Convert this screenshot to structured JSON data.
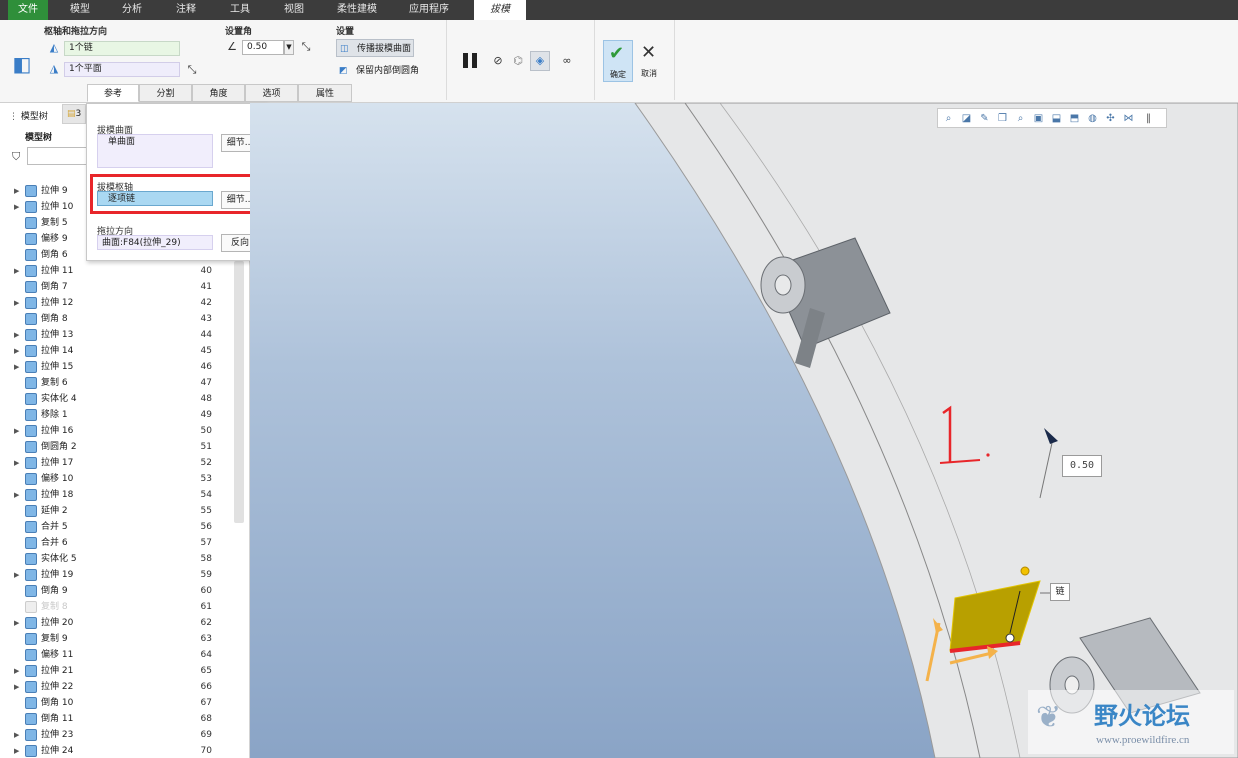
{
  "menubar": {
    "tabs": [
      {
        "label": "文件"
      },
      {
        "label": "模型"
      },
      {
        "label": "分析"
      },
      {
        "label": "注释"
      },
      {
        "label": "工具"
      },
      {
        "label": "视图"
      },
      {
        "label": "柔性建模"
      },
      {
        "label": "应用程序"
      },
      {
        "label": "拔模"
      }
    ]
  },
  "ribbon": {
    "pivot_group_title": "枢轴和拖拉方向",
    "pivot_value": "1个链",
    "pull_value": "1个平面",
    "angle_group_title": "设置角",
    "angle_value": "0.50",
    "settings_group_title": "设置",
    "propagate_label": "传播拔模曲面",
    "keep_round_label": "保留内部倒圆角",
    "ok_label": "确定",
    "cancel_label": "取消",
    "subtabs": [
      {
        "label": "参考"
      },
      {
        "label": "分割"
      },
      {
        "label": "角度"
      },
      {
        "label": "选项"
      },
      {
        "label": "属性"
      }
    ]
  },
  "leftpanel": {
    "tab_model_tree": "模型树",
    "tab_second": "3",
    "tree_header": "模型树",
    "rows": [
      {
        "label": "拉伸 9",
        "num": "",
        "arrow": true
      },
      {
        "label": "拉伸 10",
        "num": "",
        "arrow": true
      },
      {
        "label": "复制 5",
        "num": "",
        "arrow": false
      },
      {
        "label": "偏移 9",
        "num": "",
        "arrow": false
      },
      {
        "label": "倒角 6",
        "num": "",
        "arrow": false
      },
      {
        "label": "拉伸 11",
        "num": "40",
        "arrow": true
      },
      {
        "label": "倒角 7",
        "num": "41",
        "arrow": false
      },
      {
        "label": "拉伸 12",
        "num": "42",
        "arrow": true
      },
      {
        "label": "倒角 8",
        "num": "43",
        "arrow": false
      },
      {
        "label": "拉伸 13",
        "num": "44",
        "arrow": true
      },
      {
        "label": "拉伸 14",
        "num": "45",
        "arrow": true
      },
      {
        "label": "拉伸 15",
        "num": "46",
        "arrow": true
      },
      {
        "label": "复制 6",
        "num": "47",
        "arrow": false
      },
      {
        "label": "实体化 4",
        "num": "48",
        "arrow": false
      },
      {
        "label": "移除 1",
        "num": "49",
        "arrow": false
      },
      {
        "label": "拉伸 16",
        "num": "50",
        "arrow": true
      },
      {
        "label": "倒圆角 2",
        "num": "51",
        "arrow": false
      },
      {
        "label": "拉伸 17",
        "num": "52",
        "arrow": true
      },
      {
        "label": "偏移 10",
        "num": "53",
        "arrow": false
      },
      {
        "label": "拉伸 18",
        "num": "54",
        "arrow": true
      },
      {
        "label": "延伸 2",
        "num": "55",
        "arrow": false
      },
      {
        "label": "合并 5",
        "num": "56",
        "arrow": false
      },
      {
        "label": "合并 6",
        "num": "57",
        "arrow": false
      },
      {
        "label": "实体化 5",
        "num": "58",
        "arrow": false
      },
      {
        "label": "拉伸 19",
        "num": "59",
        "arrow": true
      },
      {
        "label": "倒角 9",
        "num": "60",
        "arrow": false
      },
      {
        "label": "复制 8",
        "num": "61",
        "arrow": false,
        "disabled": true
      },
      {
        "label": "拉伸 20",
        "num": "62",
        "arrow": true
      },
      {
        "label": "复制 9",
        "num": "63",
        "arrow": false
      },
      {
        "label": "偏移 11",
        "num": "64",
        "arrow": false
      },
      {
        "label": "拉伸 21",
        "num": "65",
        "arrow": true
      },
      {
        "label": "拉伸 22",
        "num": "66",
        "arrow": true
      },
      {
        "label": "倒角 10",
        "num": "67",
        "arrow": false
      },
      {
        "label": "倒角 11",
        "num": "68",
        "arrow": false
      },
      {
        "label": "拉伸 23",
        "num": "69",
        "arrow": true
      },
      {
        "label": "拉伸 24",
        "num": "70",
        "arrow": true
      }
    ]
  },
  "refpanel": {
    "draft_surface_label": "拔模曲面",
    "draft_surface_value": "单曲面",
    "details_label": "细节...",
    "pivot_label": "拔模枢轴",
    "pivot_value": "逐项链",
    "pull_dir_label": "拖拉方向",
    "pull_dir_value": "曲面:F84(拉伸_29)",
    "flip_label": "反向"
  },
  "viewport": {
    "handwritten_note": "1.",
    "dimension_value": "0.50",
    "chain_tag": "链",
    "watermark_cn": "野火论坛",
    "watermark_url": "www.proewildfire.cn"
  },
  "colors": {
    "file_tab": "#2f8f3a",
    "highlight_red": "#e8262a",
    "surface_yellow": "#b8a000",
    "arrow_orange": "#f4b24a"
  }
}
